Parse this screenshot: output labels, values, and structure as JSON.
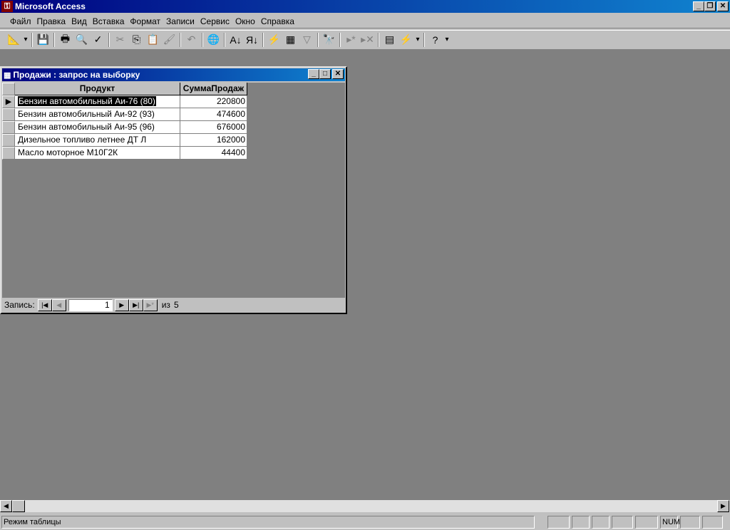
{
  "app": {
    "title": "Microsoft Access"
  },
  "menu": [
    "Файл",
    "Правка",
    "Вид",
    "Вставка",
    "Формат",
    "Записи",
    "Сервис",
    "Окно",
    "Справка"
  ],
  "toolbar": [
    {
      "icon": "design-view-icon",
      "g": "📐"
    },
    {
      "icon": "dropdown-icon",
      "g": "▾"
    },
    {
      "sep": true
    },
    {
      "icon": "save-icon",
      "g": "💾"
    },
    {
      "sep": true
    },
    {
      "icon": "print-icon",
      "g": "🖶"
    },
    {
      "icon": "print-preview-icon",
      "g": "🔍"
    },
    {
      "icon": "spelling-icon",
      "g": "✓"
    },
    {
      "sep": true
    },
    {
      "icon": "cut-icon",
      "g": "✂",
      "dis": true
    },
    {
      "icon": "copy-icon",
      "g": "⎘"
    },
    {
      "icon": "paste-icon",
      "g": "📋",
      "dis": true
    },
    {
      "icon": "format-painter-icon",
      "g": "🖌",
      "dis": true
    },
    {
      "sep": true
    },
    {
      "icon": "undo-icon",
      "g": "↶",
      "dis": true
    },
    {
      "sep": true
    },
    {
      "icon": "hyperlink-icon",
      "g": "🌐",
      "dis": true
    },
    {
      "sep": true
    },
    {
      "icon": "sort-ascending-icon",
      "g": "А↓"
    },
    {
      "icon": "sort-descending-icon",
      "g": "Я↓"
    },
    {
      "sep": true
    },
    {
      "icon": "filter-by-selection-icon",
      "g": "⚡"
    },
    {
      "icon": "filter-by-form-icon",
      "g": "▦"
    },
    {
      "icon": "apply-filter-icon",
      "g": "▽",
      "dis": true
    },
    {
      "sep": true
    },
    {
      "icon": "find-icon",
      "g": "🔭"
    },
    {
      "sep": true
    },
    {
      "icon": "new-record-icon",
      "g": "▸*",
      "dis": true
    },
    {
      "icon": "delete-record-icon",
      "g": "▸✕",
      "dis": true
    },
    {
      "sep": true
    },
    {
      "icon": "database-window-icon",
      "g": "▤"
    },
    {
      "icon": "new-object-icon",
      "g": "⚡"
    },
    {
      "icon": "dropdown-icon",
      "g": "▾"
    },
    {
      "sep": true
    },
    {
      "icon": "help-icon",
      "g": "?"
    },
    {
      "icon": "dropdown-icon",
      "g": "▾"
    }
  ],
  "window": {
    "title": "Продажи : запрос на выборку"
  },
  "table": {
    "columns": [
      "Продукт",
      "СуммаПродаж"
    ],
    "rows": [
      [
        "Бензин автомобильный Аи-76 (80)",
        "220800"
      ],
      [
        "Бензин автомобильный Аи-92 (93)",
        "474600"
      ],
      [
        "Бензин автомобильный Аи-95 (96)",
        "676000"
      ],
      [
        "Дизельное топливо летнее ДТ Л",
        "162000"
      ],
      [
        "Масло моторное М10Г2К",
        "44400"
      ]
    ]
  },
  "nav": {
    "label": "Запись:",
    "current": "1",
    "of_label": "из",
    "total": "5"
  },
  "status": {
    "text": "Режим таблицы",
    "num": "NUM"
  }
}
